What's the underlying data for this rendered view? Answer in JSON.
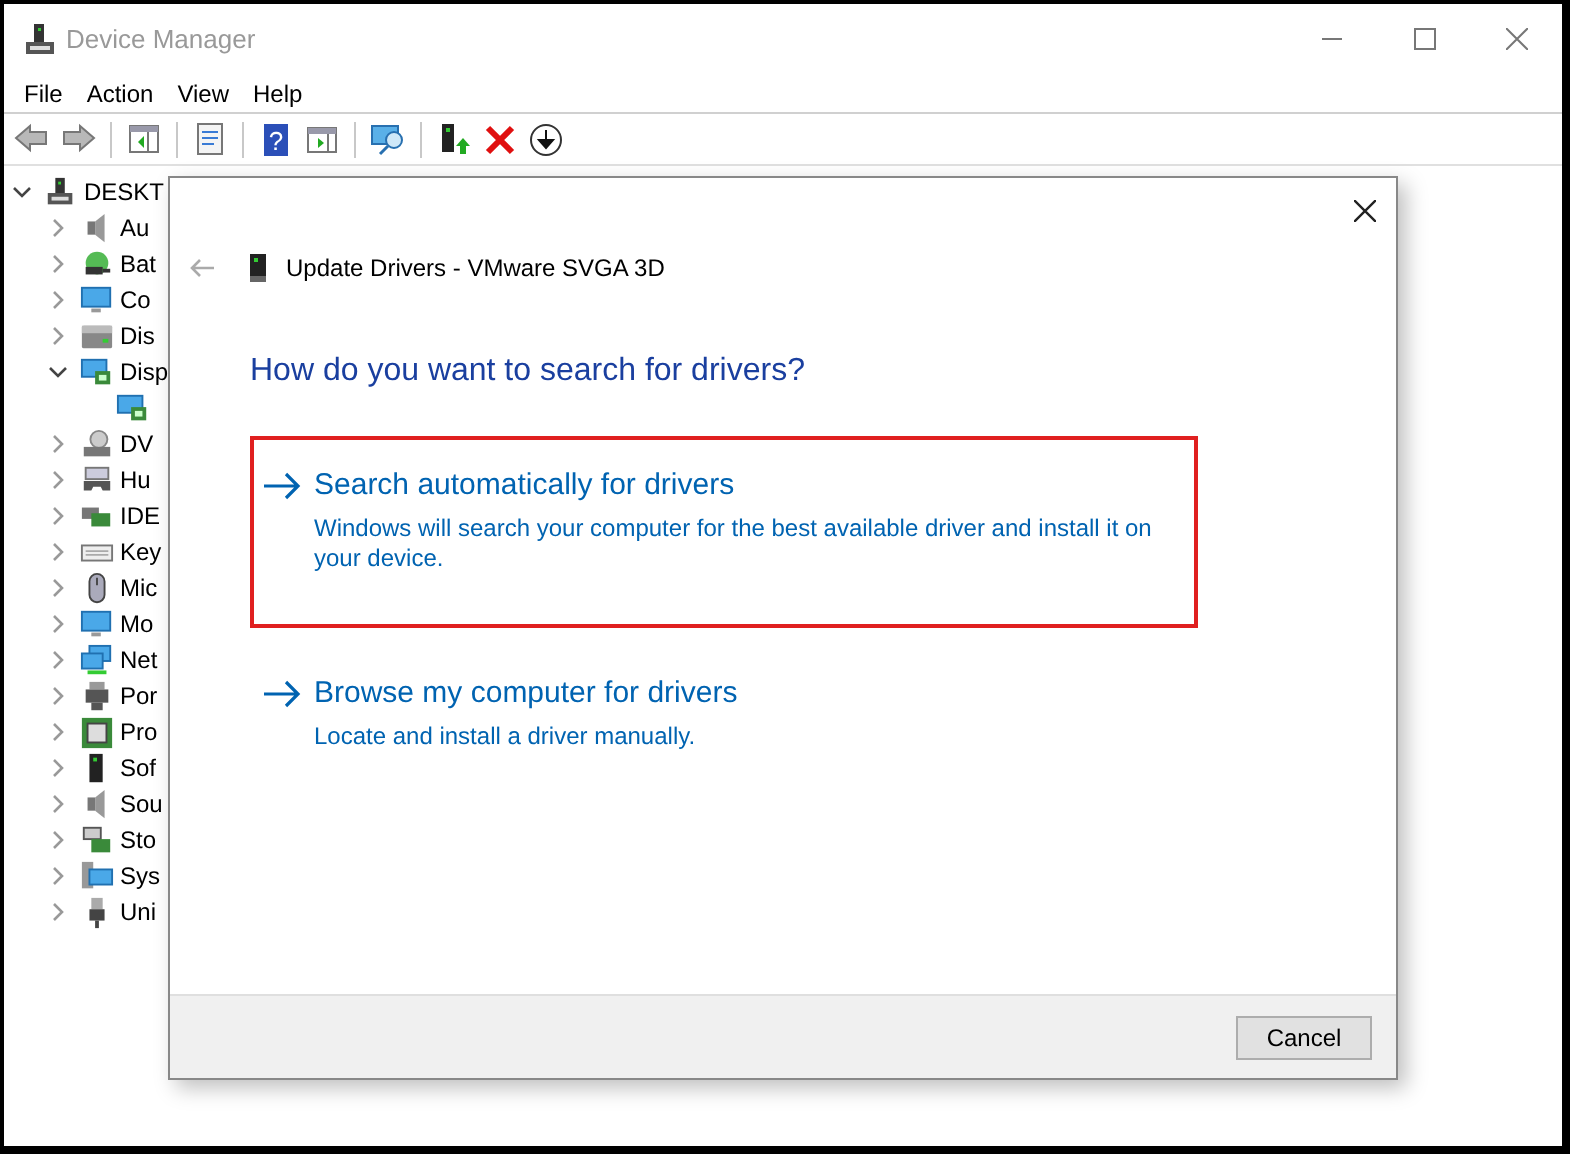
{
  "window": {
    "title": "Device Manager"
  },
  "menu": [
    "File",
    "Action",
    "View",
    "Help"
  ],
  "toolbar": [
    {
      "kind": "back",
      "disabled": true
    },
    {
      "kind": "forward",
      "disabled": true
    },
    {
      "kind": "sep"
    },
    {
      "kind": "tree"
    },
    {
      "kind": "sep"
    },
    {
      "kind": "properties"
    },
    {
      "kind": "sep"
    },
    {
      "kind": "help",
      "glyph": "?"
    },
    {
      "kind": "run"
    },
    {
      "kind": "sep"
    },
    {
      "kind": "scan"
    },
    {
      "kind": "sep"
    },
    {
      "kind": "update"
    },
    {
      "kind": "uninstall"
    },
    {
      "kind": "download"
    }
  ],
  "tree": [
    {
      "label": "DESKT",
      "kind": "computer",
      "expanded": true,
      "children": [
        {
          "label": "Au",
          "kind": "speaker",
          "expanded": false
        },
        {
          "label": "Bat",
          "kind": "battery",
          "expanded": false
        },
        {
          "label": "Co",
          "kind": "monitor",
          "expanded": false
        },
        {
          "label": "Dis",
          "kind": "disk",
          "expanded": false
        },
        {
          "label": "Disp",
          "kind": "display",
          "expanded": true,
          "children": [
            {
              "kind": "display"
            }
          ]
        },
        {
          "label": "DV",
          "kind": "dvd",
          "expanded": false
        },
        {
          "label": "Hu",
          "kind": "hid",
          "expanded": false
        },
        {
          "label": "IDE",
          "kind": "card",
          "expanded": false
        },
        {
          "label": "Key",
          "kind": "keyboard",
          "expanded": false
        },
        {
          "label": "Mic",
          "kind": "mouse",
          "expanded": false
        },
        {
          "label": "Mo",
          "kind": "monitor",
          "expanded": false
        },
        {
          "label": "Net",
          "kind": "network",
          "expanded": false
        },
        {
          "label": "Por",
          "kind": "port",
          "expanded": false
        },
        {
          "label": "Pro",
          "kind": "chip",
          "expanded": false
        },
        {
          "label": "Sof",
          "kind": "software",
          "expanded": false
        },
        {
          "label": "Sou",
          "kind": "speaker",
          "expanded": false
        },
        {
          "label": "Sto",
          "kind": "storage",
          "expanded": false
        },
        {
          "label": "Sys",
          "kind": "system",
          "expanded": false
        },
        {
          "label": "Uni",
          "kind": "usb",
          "expanded": false
        }
      ]
    }
  ],
  "dialog": {
    "title": "Update Drivers - VMware SVGA 3D",
    "heading": "How do you want to search for drivers?",
    "options": [
      {
        "title": "Search automatically for drivers",
        "description": "Windows will search your computer for the best available driver and install it on your device.",
        "highlighted": true
      },
      {
        "title": "Browse my computer for drivers",
        "description": "Locate and install a driver manually.",
        "highlighted": false
      }
    ],
    "buttons": [
      "Cancel"
    ]
  }
}
